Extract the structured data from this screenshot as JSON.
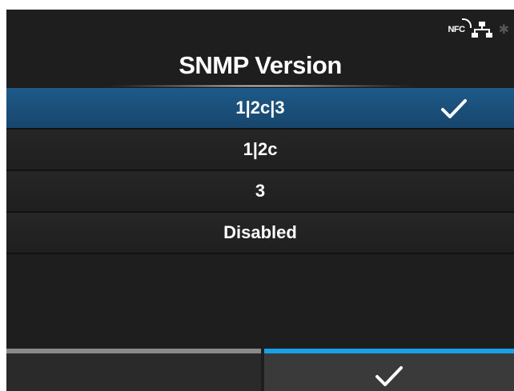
{
  "status": {
    "nfc_label": "NFC",
    "icons": [
      "nfc-icon",
      "network-icon",
      "bluetooth-icon"
    ]
  },
  "screen": {
    "title": "SNMP Version"
  },
  "options": [
    {
      "label": "1|2c|3",
      "selected": true
    },
    {
      "label": "1|2c",
      "selected": false
    },
    {
      "label": "3",
      "selected": false
    },
    {
      "label": "Disabled",
      "selected": false
    }
  ],
  "footer": {
    "left_button": "",
    "right_button_icon": "checkmark-icon"
  },
  "colors": {
    "selected_row": "#1e5a88",
    "confirm_accent": "#1aa0e6",
    "back_accent": "#8a8a8a"
  }
}
